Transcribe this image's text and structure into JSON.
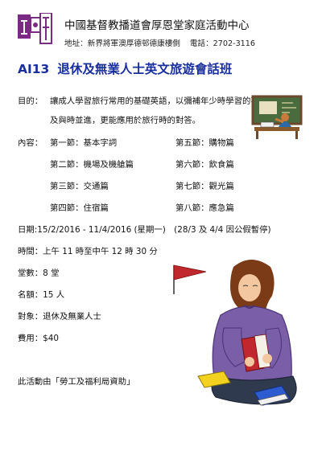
{
  "header": {
    "org_name": "中國基督教播道會厚恩堂家庭活動中心",
    "address": "地址：新界將軍澳厚德邨德康樓側",
    "phone": "電話：2702-3116",
    "logo_alt": "厚恩堂家庭"
  },
  "course": {
    "code": "AI13",
    "title": "退休及無業人士英文旅遊會話班"
  },
  "purpose": {
    "label": "目的：",
    "line1": "讓成人學習旅行常用的基礎英語，以彌補年少時學習的不足",
    "line2": "及與時並進，更能應用於旅行時的對答。"
  },
  "content": {
    "label": "內容：",
    "sessions": [
      {
        "name": "第一節：基本字詞"
      },
      {
        "name": "第二節：機場及機艙篇"
      },
      {
        "name": "第三節：交通篇"
      },
      {
        "name": "第四節：住宿篇"
      },
      {
        "name": "第五節：購物篇"
      },
      {
        "name": "第六節：飲食篇"
      },
      {
        "name": "第七節：觀光篇"
      },
      {
        "name": "第八節：應急篇"
      }
    ]
  },
  "details": {
    "date": "日期:15/2/2016 - 11/4/2016 (星期一)　(28/3 及 4/4 因公假暫停)",
    "time": "時間：上午 11 時至中午 12  時 30 分",
    "sessions_count": "堂數：8 堂",
    "quota": "名額：15 人",
    "target": "對象：退休及無業人士",
    "fee": "費用：$40"
  },
  "footer": {
    "funding": "此活動由「勞工及福利局資助」"
  }
}
